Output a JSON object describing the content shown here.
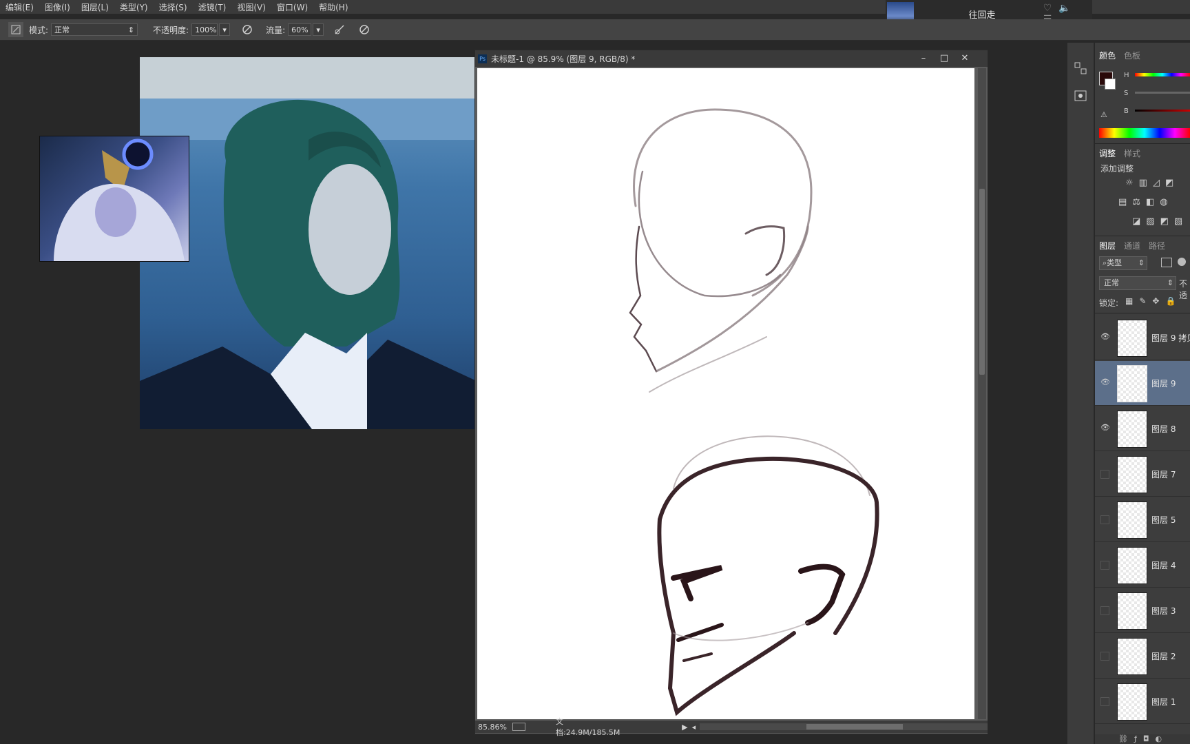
{
  "menu": [
    "编辑(E)",
    "图像(I)",
    "图层(L)",
    "类型(Y)",
    "选择(S)",
    "滤镜(T)",
    "视图(V)",
    "窗口(W)",
    "帮助(H)"
  ],
  "options": {
    "mode_label": "模式:",
    "mode_value": "正常",
    "opacity_label": "不透明度:",
    "opacity_value": "100%",
    "flow_label": "流量:",
    "flow_value": "60%"
  },
  "media": {
    "title": "往回走"
  },
  "document": {
    "title": "未标题-1 @ 85.9% (图层 9, RGB/8) *",
    "zoom": "85.86%",
    "doc_info": "文档:24.9M/185.5M"
  },
  "color_panel": {
    "tab_color": "颜色",
    "tab_swatches": "色板",
    "h": "H",
    "s": "S",
    "b": "B"
  },
  "adjust_panel": {
    "tab_adjust": "调整",
    "tab_styles": "样式",
    "add_label": "添加调整"
  },
  "layers_panel": {
    "tab_layers": "图层",
    "tab_channels": "通道",
    "tab_paths": "路径",
    "filter_kind": "类型",
    "blend_mode": "正常",
    "opacity_short": "不透",
    "lock_label": "锁定:",
    "layers": [
      {
        "name": "图层 9 拷贝",
        "visible": true,
        "selected": false
      },
      {
        "name": "图层 9",
        "visible": true,
        "selected": true
      },
      {
        "name": "图层 8",
        "visible": true,
        "selected": false
      },
      {
        "name": "图层 7",
        "visible": false,
        "selected": false
      },
      {
        "name": "图层 5",
        "visible": false,
        "selected": false
      },
      {
        "name": "图层 4",
        "visible": false,
        "selected": false
      },
      {
        "name": "图层 3",
        "visible": false,
        "selected": false
      },
      {
        "name": "图层 2",
        "visible": false,
        "selected": false
      },
      {
        "name": "图层 1",
        "visible": false,
        "selected": false
      }
    ]
  }
}
